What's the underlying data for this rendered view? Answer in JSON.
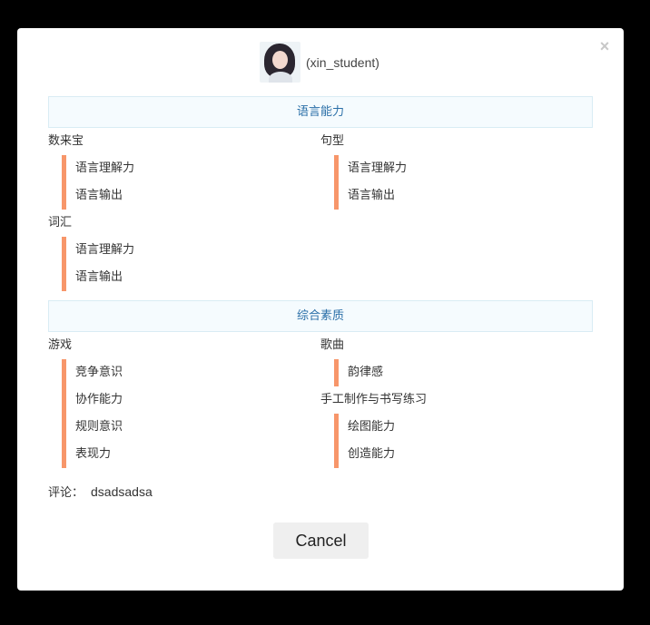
{
  "dialog": {
    "close_glyph": "×",
    "user": {
      "name": "(xin_student)"
    },
    "sections": {
      "language": {
        "title": "语言能力",
        "groups": [
          {
            "title": "数来宝",
            "items": [
              "语言理解力",
              "语言输出"
            ]
          },
          {
            "title": "句型",
            "items": [
              "语言理解力",
              "语言输出"
            ]
          },
          {
            "title": "词汇",
            "items": [
              "语言理解力",
              "语言输出"
            ]
          }
        ]
      },
      "overall": {
        "title": "综合素质",
        "groups": [
          {
            "title": "游戏",
            "items": [
              "竞争意识",
              "协作能力",
              "规则意识",
              "表现力"
            ]
          },
          {
            "title": "歌曲",
            "items": [
              "韵律感"
            ]
          },
          {
            "title": "手工制作与书写练习",
            "items": [
              "绘图能力",
              "创造能力"
            ]
          }
        ]
      }
    },
    "comment": {
      "label": "评论：",
      "value": "dsadsadsa"
    },
    "cancel_label": "Cancel"
  },
  "colors": {
    "accent_bar": "#f7966a",
    "section_text": "#2a6fa8",
    "section_bg": "#f5fbfe"
  },
  "icons": {
    "close": "close-icon"
  }
}
